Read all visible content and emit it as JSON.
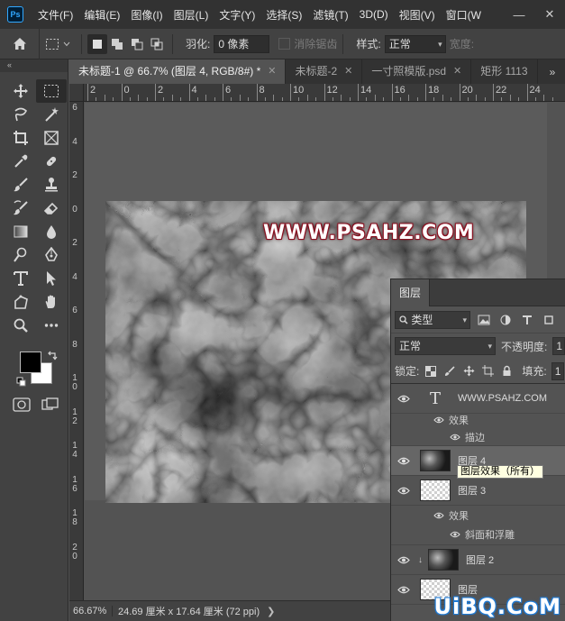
{
  "app": {
    "logo_text": "Ps"
  },
  "menubar": {
    "items": [
      "文件(F)",
      "编辑(E)",
      "图像(I)",
      "图层(L)",
      "文字(Y)",
      "选择(S)",
      "滤镜(T)",
      "3D(D)",
      "视图(V)",
      "窗口(W"
    ],
    "minimize": "—",
    "close": "✕"
  },
  "options": {
    "feather_label": "羽化:",
    "feather_value": "0 像素",
    "antialias_label": "消除锯齿",
    "style_label": "样式:",
    "style_value": "正常",
    "width_label": "宽度:"
  },
  "tabs": [
    {
      "label": "未标题-1 @ 66.7% (图层 4, RGB/8#) *",
      "active": true
    },
    {
      "label": "未标题-2",
      "active": false
    },
    {
      "label": "一寸照模版.psd",
      "active": false
    },
    {
      "label": "矩形 1113",
      "active": false
    }
  ],
  "rulers": {
    "horizontal": [
      "2",
      "0",
      "2",
      "4",
      "6",
      "8",
      "10",
      "12",
      "14",
      "16",
      "18",
      "20",
      "22",
      "24"
    ],
    "vertical": [
      "6",
      "4",
      "2",
      "0",
      "2",
      "4",
      "6",
      "8",
      "10",
      "12",
      "14",
      "16",
      "18",
      "20"
    ]
  },
  "canvas": {
    "watermark_text": "WWW.PSAHZ.COM"
  },
  "status": {
    "zoom": "66.67%",
    "doc_info": "24.69 厘米 x 17.64 厘米 (72 ppi)",
    "arrow": "❯"
  },
  "layers_panel": {
    "tab": "图层",
    "filter_kind": "类型",
    "blend_mode": "正常",
    "opacity_label": "不透明度:",
    "opacity_value": "1",
    "lock_label": "锁定:",
    "fill_label": "填充:",
    "fill_value": "1",
    "layers": {
      "text_layer": "WWW.PSAHZ.COM",
      "text_effects": "效果",
      "text_stroke": "描边",
      "layer4": "图层 4",
      "layer3": "图层 3",
      "layer3_effects": "效果",
      "layer3_bevel": "斜面和浮雕",
      "layer2": "图层 2",
      "layer1": "图层"
    }
  },
  "tooltip": "图层效果（所有）",
  "site_logo": "UiBQ.CoM"
}
